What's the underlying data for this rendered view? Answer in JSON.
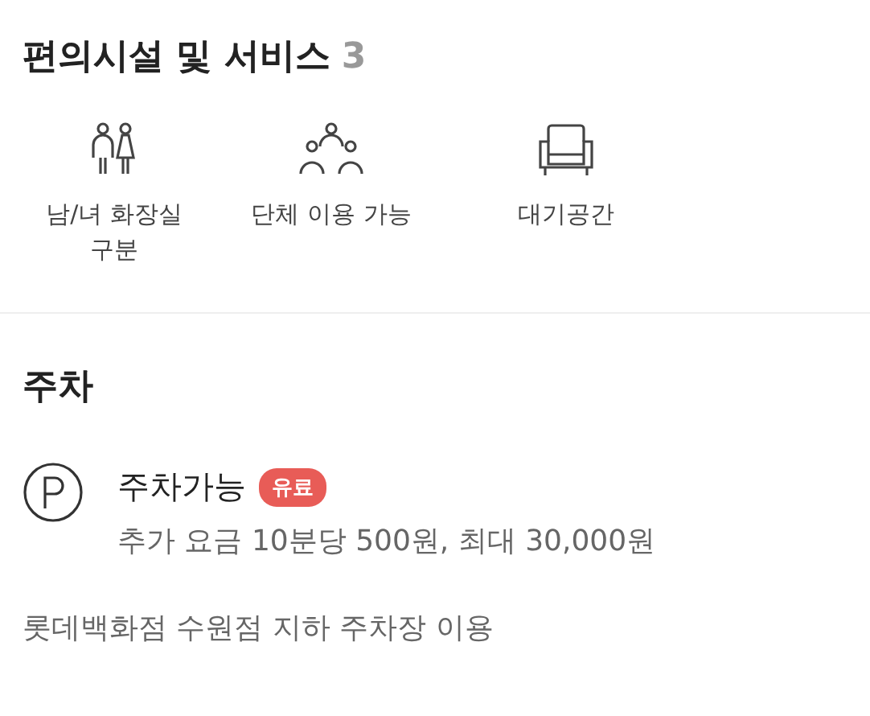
{
  "amenities": {
    "title": "편의시설 및 서비스",
    "count": "3",
    "items": [
      {
        "kind": "restroom",
        "label": "남/녀 화장실 구분"
      },
      {
        "kind": "group",
        "label": "단체 이용 가능"
      },
      {
        "kind": "lounge",
        "label": "대기공간"
      }
    ]
  },
  "parking": {
    "title": "주차",
    "status": "주차가능",
    "badge": "유료",
    "fee": "추가 요금 10분당 500원, 최대 30,000원",
    "note": "롯데백화점 수원점 지하 주차장 이용"
  }
}
